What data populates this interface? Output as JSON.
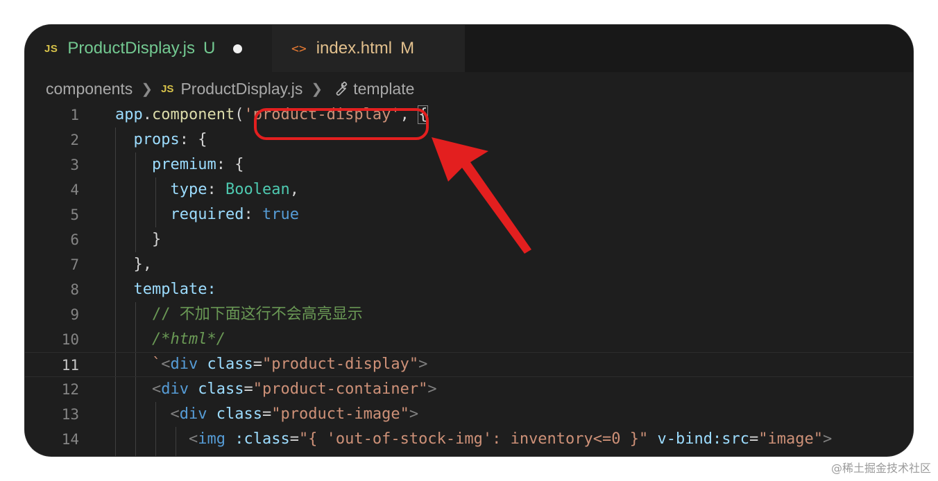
{
  "tabs": [
    {
      "icon": "JS",
      "label": "ProductDisplay.js",
      "status": "U",
      "active": true,
      "unsaved": true
    },
    {
      "icon": "<>",
      "label": "index.html",
      "status": "M",
      "active": false
    }
  ],
  "breadcrumb": {
    "folder": "components",
    "file_icon": "JS",
    "file": "ProductDisplay.js",
    "symbol": "template"
  },
  "lines": [
    {
      "n": "1"
    },
    {
      "n": "2"
    },
    {
      "n": "3"
    },
    {
      "n": "4"
    },
    {
      "n": "5"
    },
    {
      "n": "6"
    },
    {
      "n": "7"
    },
    {
      "n": "8"
    },
    {
      "n": "9"
    },
    {
      "n": "10"
    },
    {
      "n": "11"
    },
    {
      "n": "12"
    },
    {
      "n": "13"
    },
    {
      "n": "14"
    }
  ],
  "code": {
    "l1_obj": "app",
    "l1_dot": ".",
    "l1_fn": "component",
    "l1_paren": "(",
    "l1_str": "'product-display'",
    "l1_comma": ", ",
    "l1_brace": "{",
    "l2_key": "props",
    "l2_rest": ": {",
    "l3_key": "premium",
    "l3_rest": ": {",
    "l4_key": "type",
    "l4_colon": ": ",
    "l4_val": "Boolean",
    "l4_comma": ",",
    "l5_key": "required",
    "l5_colon": ": ",
    "l5_val": "true",
    "l6": "}",
    "l7": "},",
    "l8_key": "template",
    "l8_colon": ":",
    "l9": "// 不加下面这行不会高亮显示",
    "l10": "/*html*/",
    "l11_tick": "`",
    "l11_open": "<",
    "l11_tag": "div",
    "l11_attr": " class",
    "l11_eq": "=",
    "l11_val": "\"product-display\"",
    "l11_close": ">",
    "l12_open": "<",
    "l12_tag": "div",
    "l12_attr": " class",
    "l12_eq": "=",
    "l12_val": "\"product-container\"",
    "l12_close": ">",
    "l13_open": "<",
    "l13_tag": "div",
    "l13_attr": " class",
    "l13_eq": "=",
    "l13_val": "\"product-image\"",
    "l13_close": ">",
    "l14_open": "<",
    "l14_tag": "img",
    "l14_attr": " :class",
    "l14_eq": "=",
    "l14_val": "\"{ 'out-of-stock-img': inventory<=0 }\"",
    "l14_attr2": " v-bind:src",
    "l14_eq2": "=",
    "l14_val2": "\"image\"",
    "l14_close": ">"
  },
  "annotation": {
    "color": "#e31f1f"
  },
  "watermark": "@稀土掘金技术社区",
  "colors": {
    "editor_bg": "#1e1e1e",
    "string": "#ce9178",
    "keyword": "#569cd6",
    "property": "#9cdcfe",
    "comment": "#6a9955",
    "untracked": "#73c991",
    "modified": "#e2c08d"
  }
}
